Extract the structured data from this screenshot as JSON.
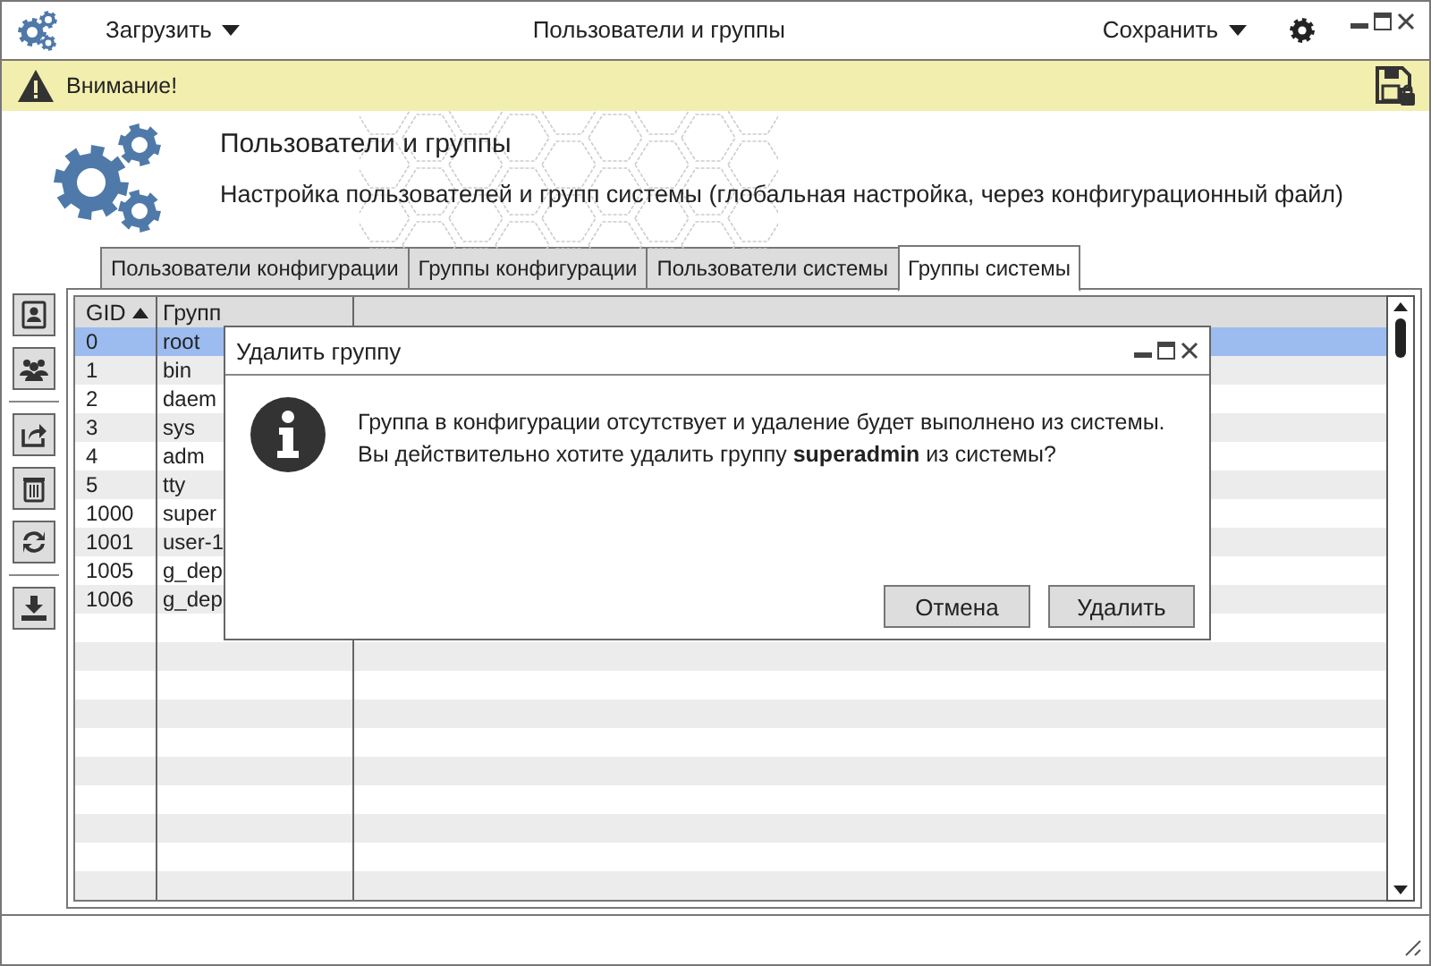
{
  "toolbar": {
    "load_menu": "Загрузить",
    "title": "Пользователи и группы",
    "save_menu": "Сохранить"
  },
  "warning": {
    "text": "Внимание!"
  },
  "header": {
    "title": "Пользователи и группы",
    "subtitle": "Настройка пользователей и групп системы (глобальная настройка, через конфигурационный файл)"
  },
  "tabs": [
    {
      "label": "Пользователи конфигурации",
      "selected": false
    },
    {
      "label": "Группы конфигурации",
      "selected": false
    },
    {
      "label": "Пользователи системы",
      "selected": false
    },
    {
      "label": "Группы системы",
      "selected": true
    }
  ],
  "table": {
    "columns": [
      "GID",
      "Групп"
    ],
    "rows": [
      {
        "gid": "0",
        "group": "root",
        "selected": true
      },
      {
        "gid": "1",
        "group": "bin",
        "selected": false
      },
      {
        "gid": "2",
        "group": "daem",
        "selected": false
      },
      {
        "gid": "3",
        "group": "sys",
        "selected": false
      },
      {
        "gid": "4",
        "group": "adm",
        "selected": false
      },
      {
        "gid": "5",
        "group": "tty",
        "selected": false
      },
      {
        "gid": "1000",
        "group": "super",
        "selected": false
      },
      {
        "gid": "1001",
        "group": "user-1",
        "selected": false
      },
      {
        "gid": "1005",
        "group": "g_dep",
        "selected": false
      },
      {
        "gid": "1006",
        "group": "g_dep",
        "selected": false
      }
    ]
  },
  "dialog": {
    "title": "Удалить группу",
    "message": [
      "Группа в конфигурации отсутствует и удаление будет выполнено из системы.",
      "Вы действительно хотите удалить группу **superadmin** из системы?"
    ],
    "buttons": [
      "Отмена",
      "Удалить"
    ]
  }
}
